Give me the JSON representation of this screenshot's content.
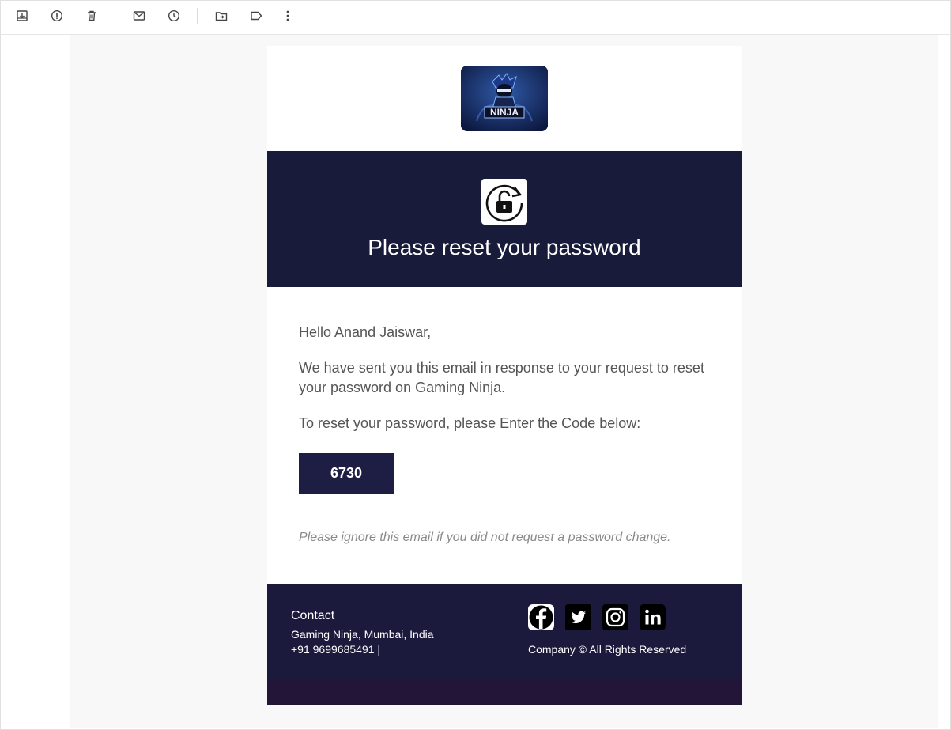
{
  "toolbar": {
    "buttons": [
      "archive-icon",
      "report-spam-icon",
      "delete-icon",
      "mark-unread-icon",
      "snooze-icon",
      "move-to-icon",
      "label-icon",
      "more-icon"
    ]
  },
  "email": {
    "brand": "Gaming Ninja",
    "logo_text": "NINJA",
    "hero_title": "Please reset your password",
    "greeting": "Hello Anand Jaiswar,",
    "paragraph1": "We have sent you this email in response to your request to reset your password on Gaming Ninja.",
    "paragraph2": "To reset your password, please Enter the Code below:",
    "code": "6730",
    "note": "Please ignore this email if you did not request a password change.",
    "footer": {
      "contact_heading": "Contact",
      "address": "Gaming Ninja, Mumbai, India",
      "phone": "+91 9699685491 |",
      "copyright": "Company ©  All Rights Reserved",
      "socials": [
        "facebook-icon",
        "twitter-icon",
        "instagram-icon",
        "linkedin-icon"
      ]
    }
  },
  "colors": {
    "hero_bg": "#181b3a",
    "footer_bg": "#1b1a3d",
    "code_bg": "#1e1e45",
    "canvas_bg": "#f8f8f8"
  }
}
